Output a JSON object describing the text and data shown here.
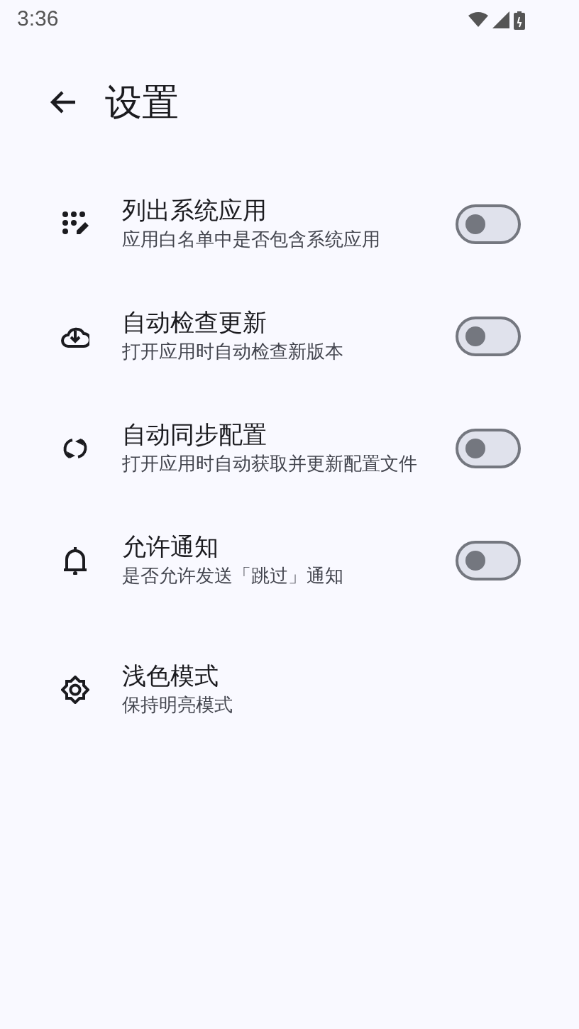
{
  "status_bar": {
    "time": "3:36"
  },
  "header": {
    "title": "设置"
  },
  "settings": [
    {
      "kind": "switch",
      "title": "列出系统应用",
      "subtitle": "应用白名单中是否包含系统应用",
      "on": false
    },
    {
      "kind": "switch",
      "title": "自动检查更新",
      "subtitle": "打开应用时自动检查新版本",
      "on": false
    },
    {
      "kind": "switch",
      "title": "自动同步配置",
      "subtitle": "打开应用时自动获取并更新配置文件",
      "on": false
    },
    {
      "kind": "switch",
      "title": "允许通知",
      "subtitle": "是否允许发送「跳过」通知",
      "on": false
    },
    {
      "kind": "plain",
      "title": "浅色模式",
      "subtitle": "保持明亮模式"
    }
  ]
}
